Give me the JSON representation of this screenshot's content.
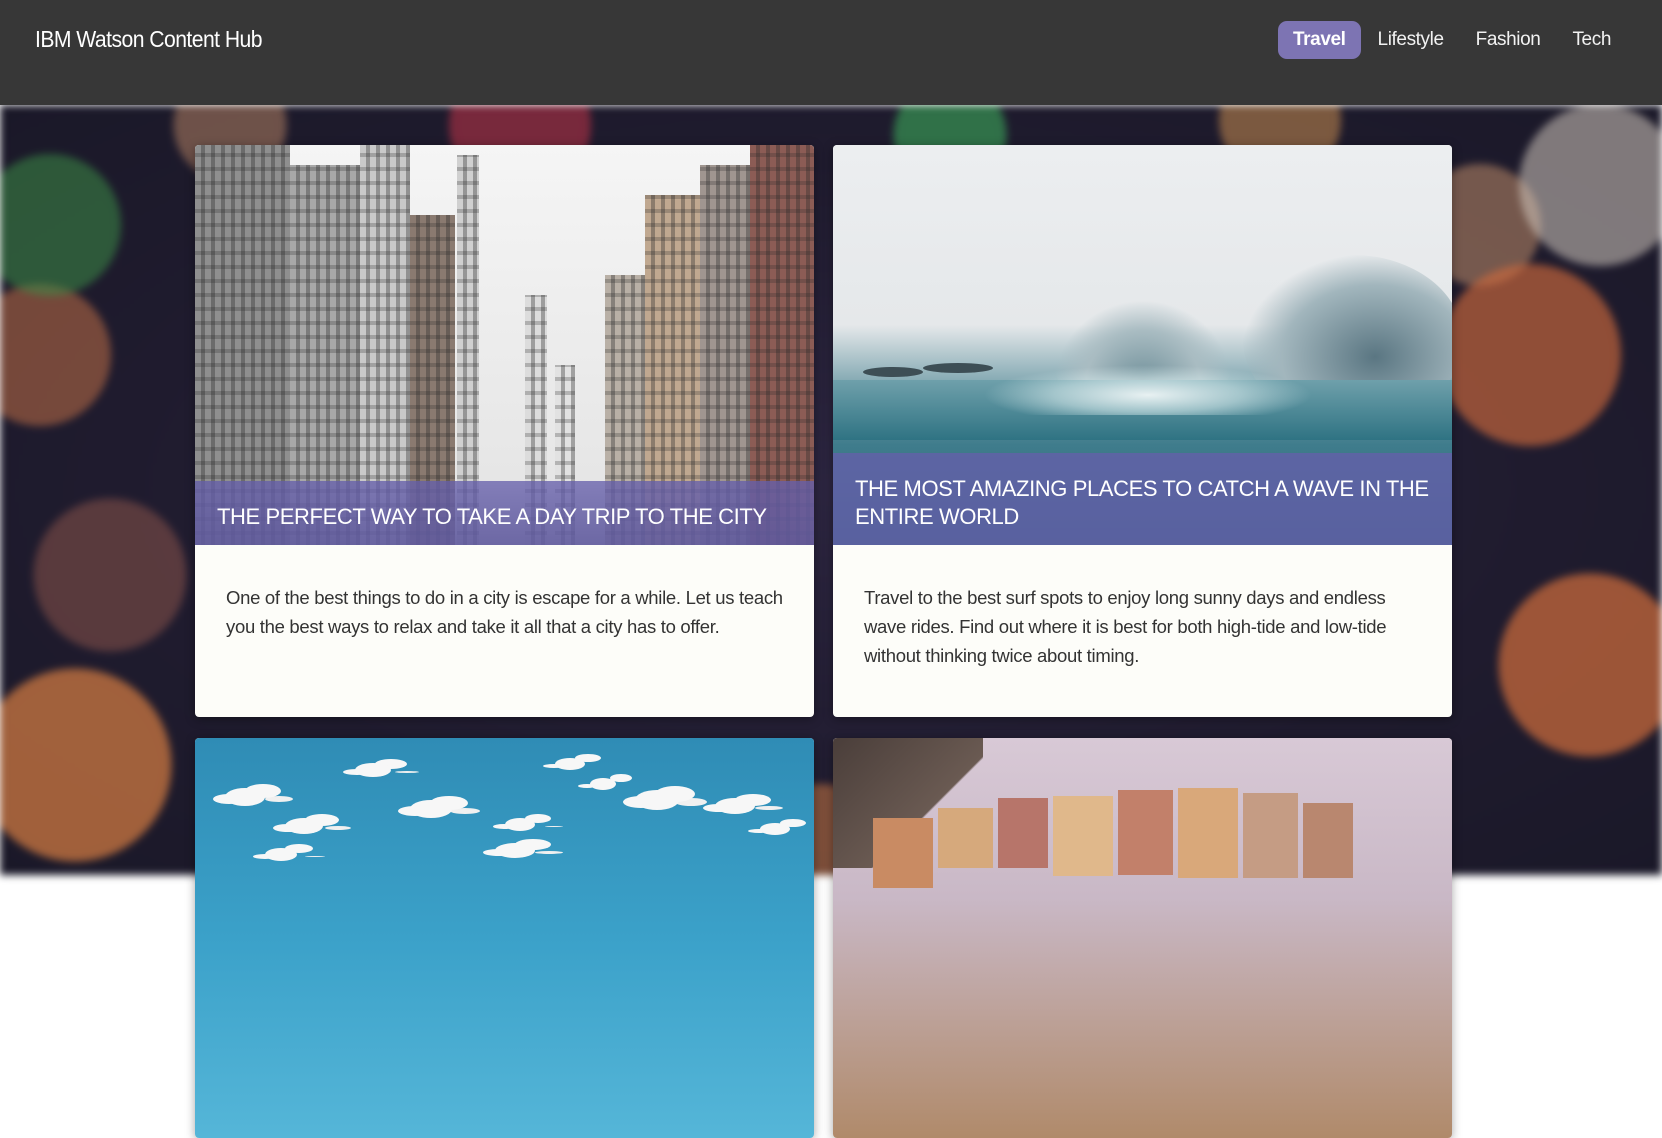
{
  "header": {
    "brand": "IBM Watson Content Hub",
    "nav": [
      {
        "label": "Travel",
        "active": true
      },
      {
        "label": "Lifestyle",
        "active": false
      },
      {
        "label": "Fashion",
        "active": false
      },
      {
        "label": "Tech",
        "active": false
      }
    ]
  },
  "cards": [
    {
      "title": "THE PERFECT WAY TO TAKE A DAY TRIP TO THE CITY",
      "description": "One of the best things to do in a city is escape for a while. Let us teach you the best ways to relax and take it all that a city has to offer.",
      "image": "city-street-image"
    },
    {
      "title": "THE MOST AMAZING PLACES TO CATCH A WAVE IN THE ENTIRE WORLD",
      "description": "Travel to the best surf spots to enjoy long sunny days and endless wave rides. Find out where it is best for both high-tide and low-tide without thinking twice about timing.",
      "image": "ocean-wave-image"
    },
    {
      "title": "",
      "description": "",
      "image": "blue-sky-clouds-image"
    },
    {
      "title": "",
      "description": "",
      "image": "coastal-village-image"
    }
  ],
  "colors": {
    "header_bg": "#373737",
    "accent": "#7d74b3",
    "title_band": "#655faa",
    "card_bg": "#fdfdf9"
  }
}
